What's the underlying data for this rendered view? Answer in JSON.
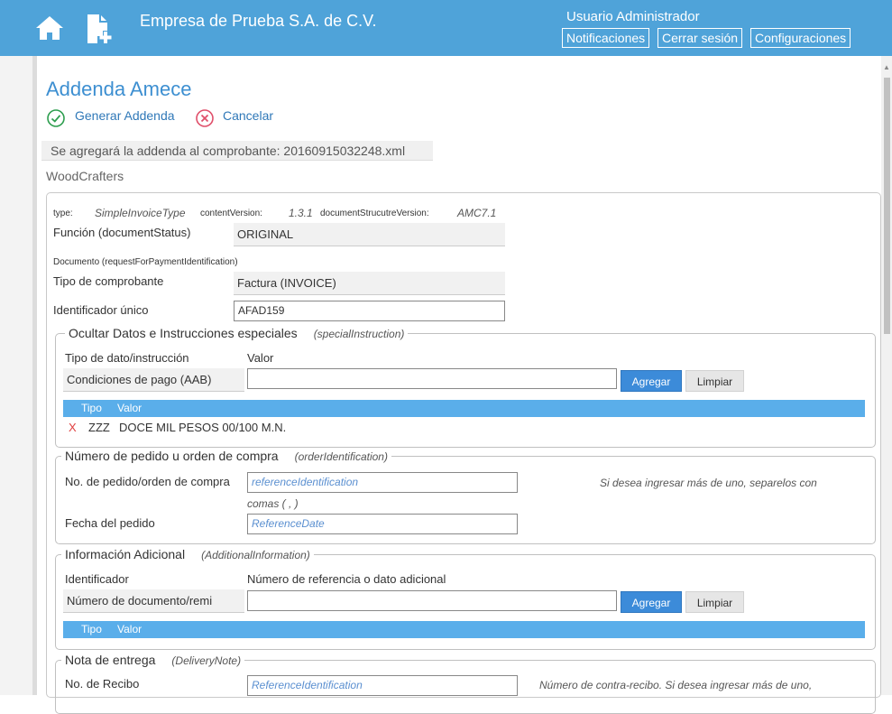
{
  "header": {
    "company": "Empresa de Prueba S.A. de C.V.",
    "user": "Usuario Administrador",
    "buttons": [
      "Notificaciones",
      "Cerrar sesión",
      "Configuraciones"
    ]
  },
  "page": {
    "title": "Addenda Amece",
    "actions": {
      "generate": "Generar Addenda",
      "cancel": "Cancelar"
    },
    "notice": "Se agregará la addenda al comprobante: 20160915032248.xml",
    "addenda_name": "WoodCrafters"
  },
  "meta": {
    "type_label": "type:",
    "type_value": "SimpleInvoiceType",
    "cv_label": "contentVersion:",
    "cv_value": "1.3.1",
    "dsv_label": "documentStrucutreVersion:",
    "dsv_value": "AMC7.1"
  },
  "document": {
    "funcion_label": "Función (documentStatus)",
    "funcion_value": "ORIGINAL",
    "doc_label": "Documento (requestForPaymentIdentification)",
    "tipo_label": "Tipo de comprobante",
    "tipo_value": "Factura (INVOICE)",
    "id_label": "Identificador único",
    "id_value": "AFAD159"
  },
  "special": {
    "legend": "Ocultar Datos e Instrucciones especiales",
    "legend_code": "(specialInstruction)",
    "col1": "Tipo de dato/instrucción",
    "col2": "Valor",
    "select_value": "Condiciones de pago (AAB)",
    "input_value": "",
    "add": "Agregar",
    "clear": "Limpiar",
    "table_headers": [
      "Tipo",
      "Valor"
    ],
    "rows": [
      {
        "remove": "X",
        "tipo": "ZZZ",
        "valor": "DOCE MIL PESOS 00/100 M.N."
      }
    ]
  },
  "order": {
    "legend": "Número de pedido u orden de compra",
    "legend_code": "(orderIdentification)",
    "no_label": "No. de pedido/orden de compra",
    "no_placeholder": "referenceIdentification",
    "hint": "Si desea ingresar más de uno, separelos con",
    "hint2": "comas ( , )",
    "fecha_label": "Fecha del pedido",
    "fecha_placeholder": "ReferenceDate"
  },
  "additional": {
    "legend": "Información Adicional",
    "legend_code": "(AdditionalInformation)",
    "col1": "Identificador",
    "col2": "Número de referencia o dato adicional",
    "select_value": "Número de documento/remi",
    "add": "Agregar",
    "clear": "Limpiar",
    "table_headers": [
      "Tipo",
      "Valor"
    ]
  },
  "delivery": {
    "legend": "Nota de entrega",
    "legend_code": "(DeliveryNote)",
    "no_label": "No. de Recibo",
    "no_placeholder": "ReferenceIdentification",
    "hint": "Número de contra-recibo. Si desea ingresar más de uno,"
  },
  "colors": {
    "header": "#4fa3d9",
    "accent": "#3d8fd1",
    "table_header": "#5aaeea",
    "button": "#3c8bd9"
  }
}
